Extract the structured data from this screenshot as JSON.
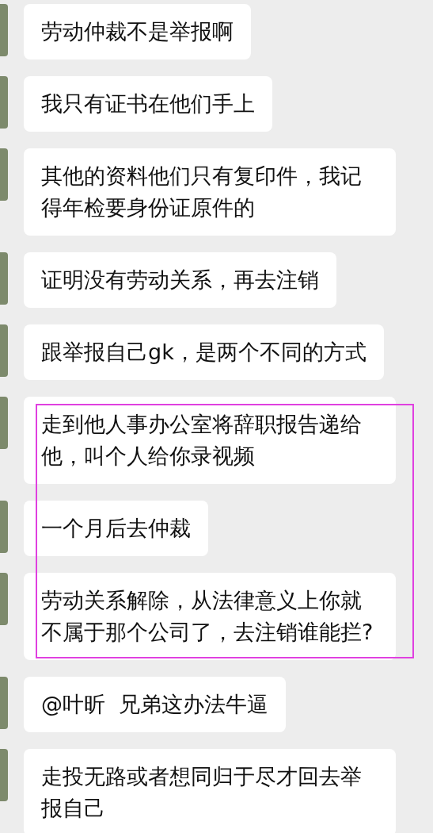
{
  "messages": [
    {
      "text": "劳动仲裁不是举报啊",
      "highlighted": false
    },
    {
      "text": "我只有证书在他们手上",
      "highlighted": false
    },
    {
      "text": "其他的资料他们只有复印件，我记得年检要身份证原件的",
      "highlighted": false
    },
    {
      "text": "证明没有劳动关系，再去注销",
      "highlighted": false
    },
    {
      "text": "跟举报自己gk，是两个不同的方式",
      "highlighted": false
    },
    {
      "text": "走到他人事办公室将辞职报告递给他，叫个人给你录视频",
      "highlighted": true
    },
    {
      "text": "一个月后去仲裁",
      "highlighted": true
    },
    {
      "text": "劳动关系解除，从法律意义上你就不属于那个公司了，去注销谁能拦?",
      "highlighted": true
    },
    {
      "text": "@叶昕  兄弟这办法牛逼",
      "highlighted": false
    },
    {
      "text": "走投无路或者想同归于尽才回去举报自己",
      "highlighted": false
    }
  ]
}
